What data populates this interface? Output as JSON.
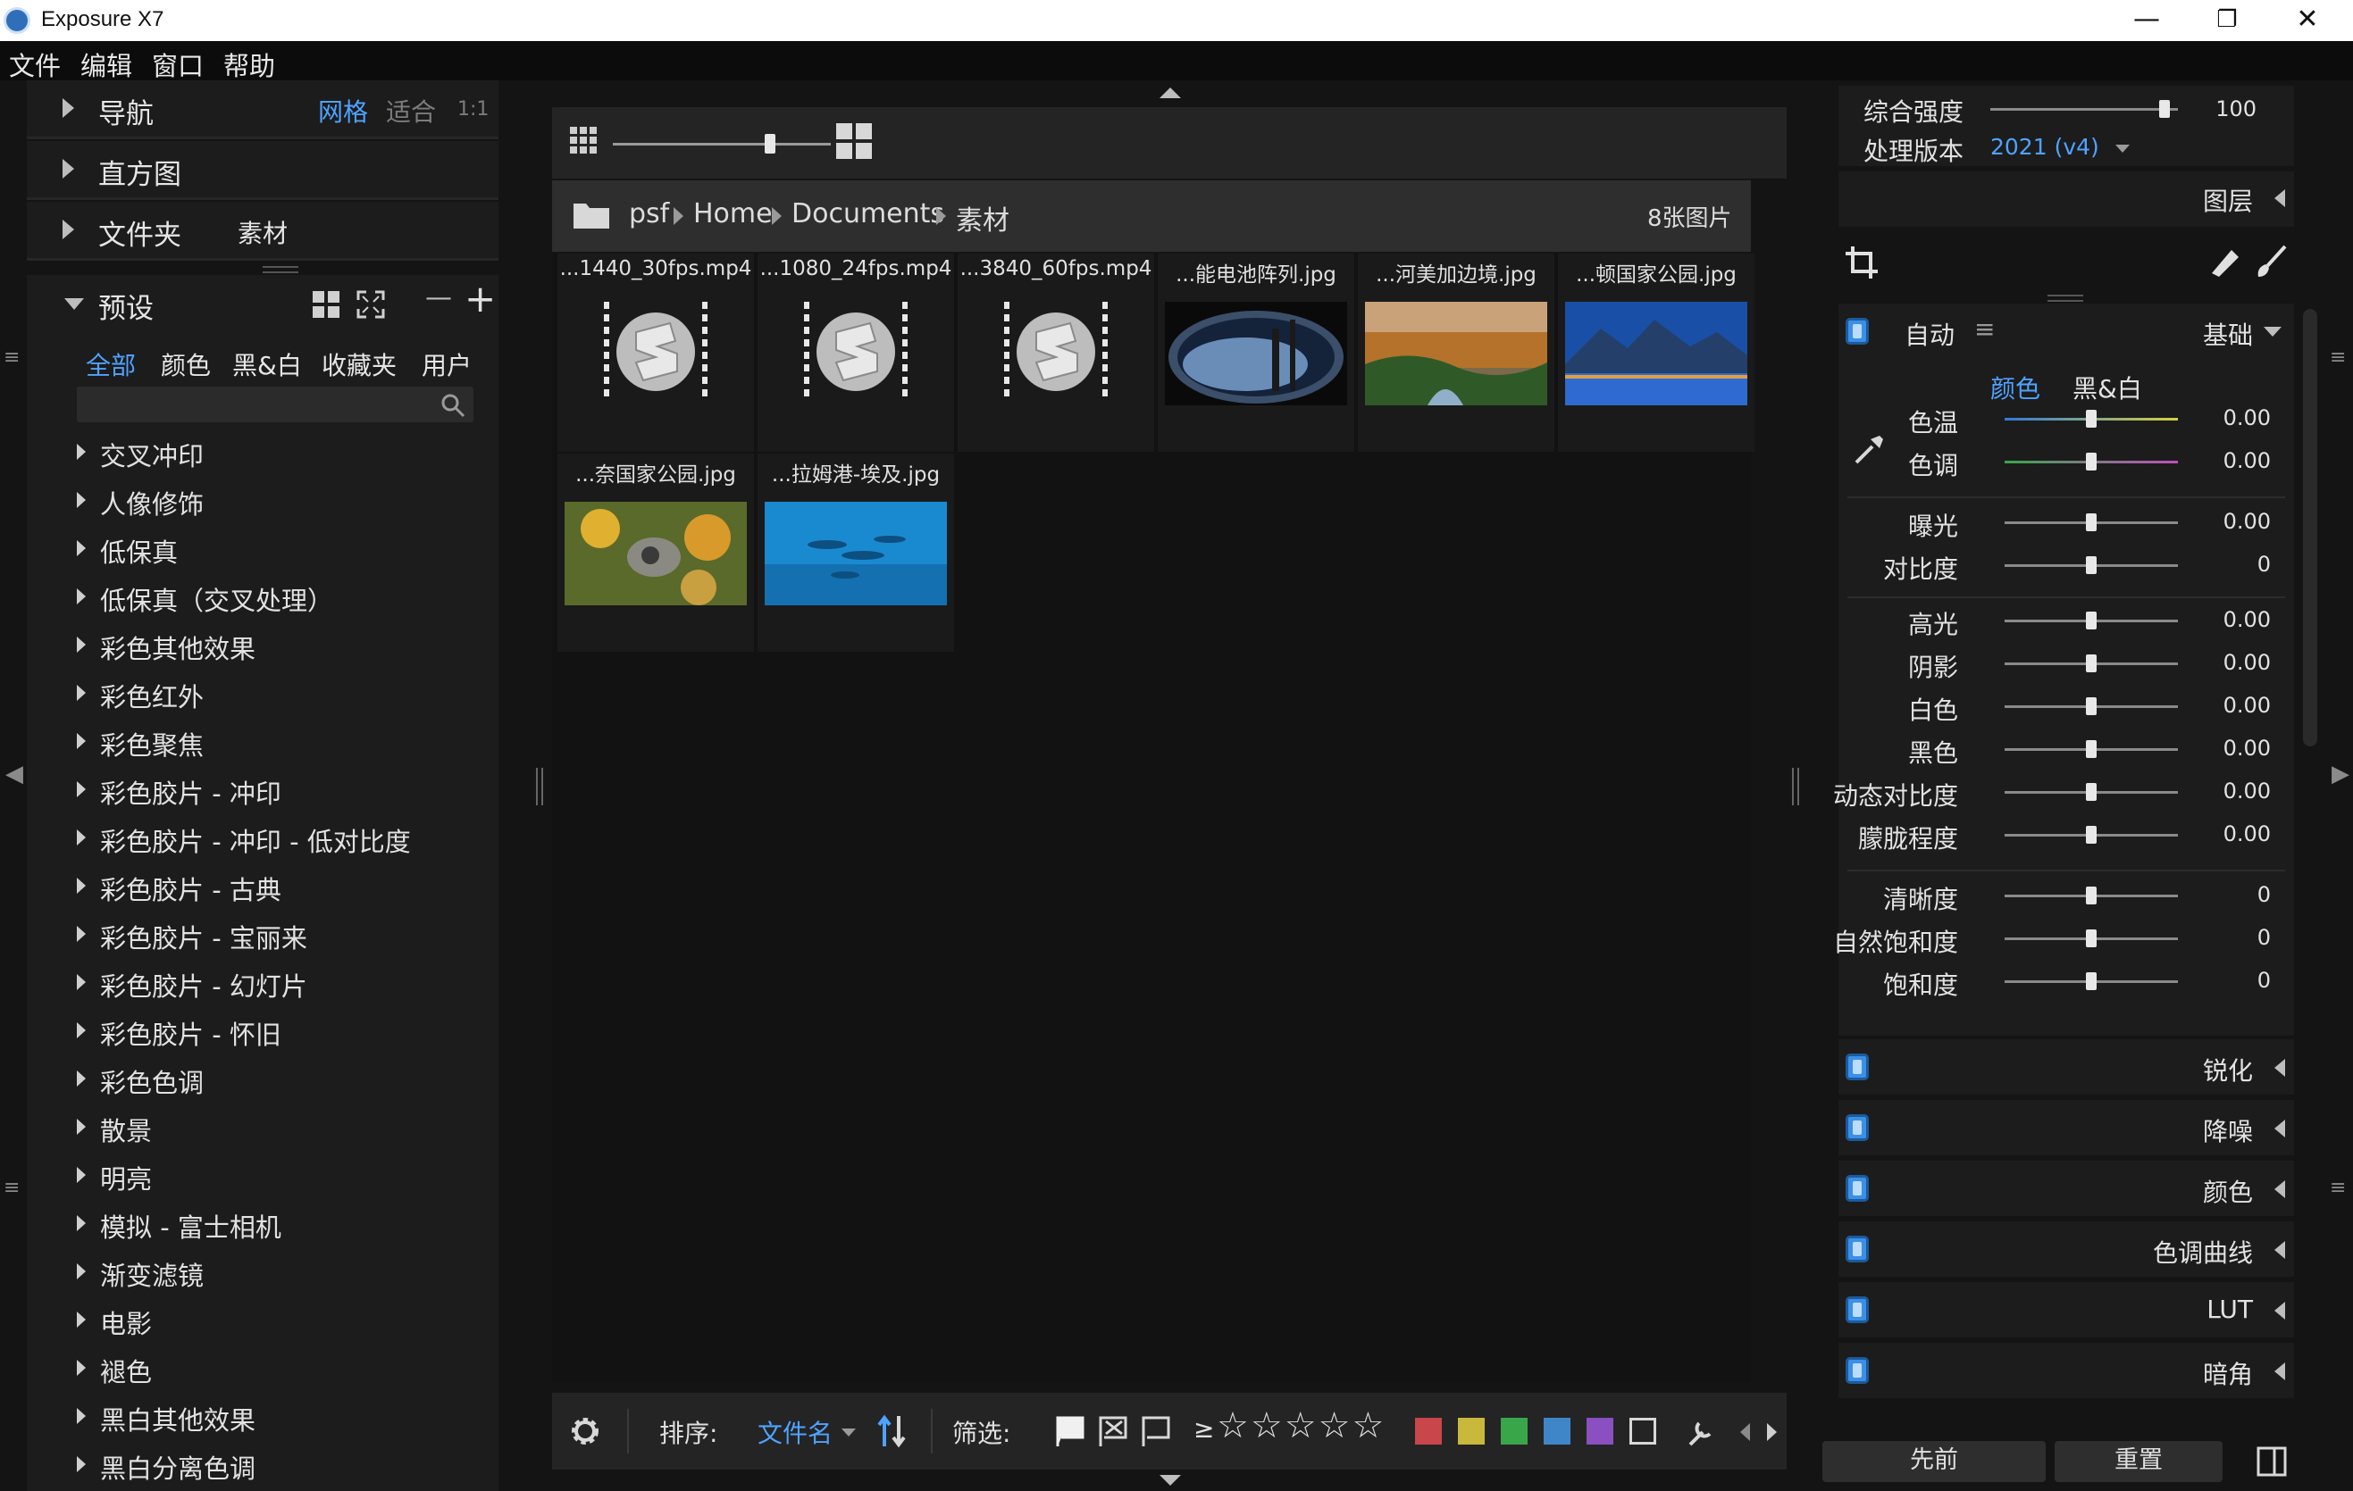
{
  "window": {
    "title": "Exposure X7",
    "minimize": "—",
    "restore": "❐",
    "close": "✕"
  },
  "menu": [
    "文件",
    "编辑",
    "窗口",
    "帮助"
  ],
  "left": {
    "nav": {
      "label": "导航",
      "view_grid": "网格",
      "view_fit": "适合",
      "view_1to1": "1:1"
    },
    "histogram": {
      "label": "直方图"
    },
    "folder": {
      "label": "文件夹",
      "value": "素材"
    },
    "presets": {
      "label": "预设",
      "minus": "—",
      "plus": "+",
      "tabs": [
        "全部",
        "颜色",
        "黑&白",
        "收藏夹",
        "用户"
      ],
      "active_tab": "全部",
      "items": [
        "交叉冲印",
        "人像修饰",
        "低保真",
        "低保真（交叉处理）",
        "彩色其他效果",
        "彩色红外",
        "彩色聚焦",
        "彩色胶片 - 冲印",
        "彩色胶片 - 冲印 - 低对比度",
        "彩色胶片 - 古典",
        "彩色胶片 - 宝丽来",
        "彩色胶片 - 幻灯片",
        "彩色胶片 - 怀旧",
        "彩色色调",
        "散景",
        "明亮",
        "模拟 - 富士相机",
        "渐变滤镜",
        "电影",
        "褪色",
        "黑白其他效果",
        "黑白分离色调"
      ]
    }
  },
  "browser": {
    "thumb_size": 0.72,
    "breadcrumb": [
      "psf",
      "Home",
      "Documents",
      "素材"
    ],
    "count": "8张图片",
    "files": [
      {
        "name": "...1440_30fps.mp4",
        "kind": "video"
      },
      {
        "name": "...1080_24fps.mp4",
        "kind": "video"
      },
      {
        "name": "...3840_60fps.mp4",
        "kind": "video"
      },
      {
        "name": "...能电池阵列.jpg",
        "kind": "image-space"
      },
      {
        "name": "...河美加边境.jpg",
        "kind": "image-forest"
      },
      {
        "name": "...顿国家公园.jpg",
        "kind": "image-lake"
      },
      {
        "name": "...奈国家公园.jpg",
        "kind": "image-flower"
      },
      {
        "name": "...拉姆港-埃及.jpg",
        "kind": "image-ocean"
      }
    ],
    "bottom": {
      "sort_label": "排序:",
      "sort_value": "文件名",
      "filter_label": "筛选:",
      "rating_prefix": "≥",
      "stars": "☆☆☆☆☆",
      "colors": [
        "#c9464a",
        "#c8b93c",
        "#3aa64a",
        "#3f86c9",
        "#8a4fc0"
      ]
    }
  },
  "right": {
    "intensity_label": "综合强度",
    "intensity_value": "100",
    "intensity_level": 0.93,
    "version_label": "处理版本",
    "version_value": "2021 (v4)",
    "layers_label": "图层",
    "basic": {
      "auto_label": "自动",
      "section_label": "基础",
      "mode_tabs": [
        "颜色",
        "黑&白"
      ],
      "active_mode": "颜色",
      "sliders": [
        {
          "label": "色温",
          "value": "0.00",
          "level": 0.5,
          "track": "temp"
        },
        {
          "label": "色调",
          "value": "0.00",
          "level": 0.5,
          "track": "tint"
        },
        {
          "label": "曝光",
          "value": "0.00",
          "level": 0.5
        },
        {
          "label": "对比度",
          "value": "0",
          "level": 0.5
        },
        {
          "label": "高光",
          "value": "0.00",
          "level": 0.5
        },
        {
          "label": "阴影",
          "value": "0.00",
          "level": 0.5
        },
        {
          "label": "白色",
          "value": "0.00",
          "level": 0.5
        },
        {
          "label": "黑色",
          "value": "0.00",
          "level": 0.5
        },
        {
          "label": "动态对比度",
          "value": "0.00",
          "level": 0.5
        },
        {
          "label": "朦胧程度",
          "value": "0.00",
          "level": 0.5
        },
        {
          "label": "清晰度",
          "value": "0",
          "level": 0.5
        },
        {
          "label": "自然饱和度",
          "value": "0",
          "level": 0.5
        },
        {
          "label": "饱和度",
          "value": "0",
          "level": 0.5
        }
      ]
    },
    "sections": [
      "锐化",
      "降噪",
      "颜色",
      "色调曲线",
      "LUT",
      "暗角"
    ],
    "prev_button": "先前",
    "reset_button": "重置"
  }
}
